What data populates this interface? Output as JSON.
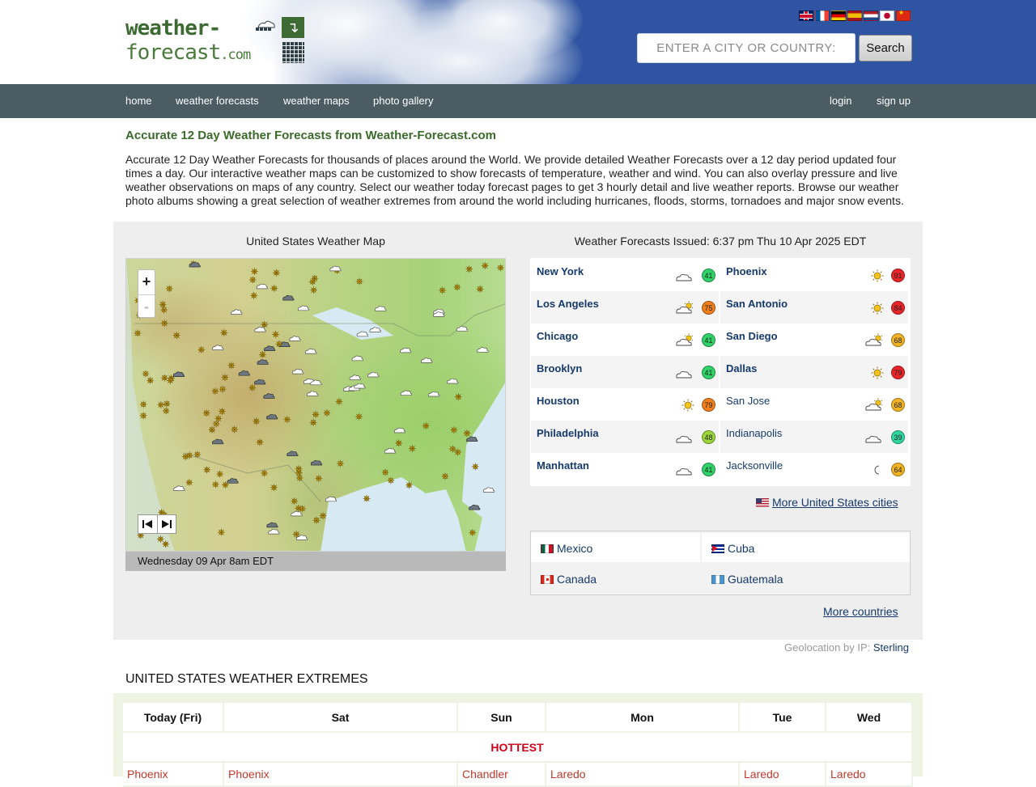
{
  "header": {
    "logo_line1": "weather-",
    "logo_line2": "forecast",
    "logo_com": ".com",
    "languages": [
      "uk-flag",
      "fr-flag",
      "de-flag",
      "es-flag",
      "nl-flag",
      "jp-flag",
      "cn-flag"
    ],
    "search_placeholder": "ENTER A CITY OR COUNTRY:",
    "search_button": "Search"
  },
  "nav": {
    "items": [
      "home",
      "weather forecasts",
      "weather maps",
      "photo gallery"
    ],
    "login": "login",
    "signup": "sign up"
  },
  "intro": {
    "title": "Accurate 12 Day Weather Forecasts from Weather-Forecast.com",
    "text": "Accurate 12 Day Weather Forecasts for thousands of places around the World. We provide detailed Weather Forecasts over a 12 day period updated four times a day. Our interactive weather maps can be customized to show forecasts of temperature, weather and wind. You can also overlay pressure and live weather observations on maps of any country. Select our weather today forecast pages to get 3 hourly detail and live weather reports. Browse our weather photo albums showing a great selection of weather extremes from around the world including hurricanes, floods, storms, tornadoes and major snow events."
  },
  "map": {
    "title": "United States Weather Map",
    "zoom_in": "+",
    "zoom_out": "-",
    "timestamp": "Wednesday 09 Apr 8am EDT"
  },
  "forecasts": {
    "issued": "Weather Forecasts Issued: 6:37 pm Thu 10 Apr 2025 EDT",
    "cities": [
      {
        "name": "New York",
        "icon": "cloud-icon",
        "temp": "41",
        "color": "#2fd36a"
      },
      {
        "name": "Phoenix",
        "icon": "sun-icon",
        "temp": "91",
        "color": "#e8262a"
      },
      {
        "name": "Los Angeles",
        "icon": "partly-cloudy-icon",
        "temp": "75",
        "color": "#f07f1c"
      },
      {
        "name": "San Antonio",
        "icon": "sun-icon",
        "temp": "84",
        "color": "#e8262a"
      },
      {
        "name": "Chicago",
        "icon": "partly-cloudy-icon",
        "temp": "41",
        "color": "#2fd36a"
      },
      {
        "name": "San Diego",
        "icon": "partly-cloudy-icon",
        "temp": "68",
        "color": "#f2b322"
      },
      {
        "name": "Brooklyn",
        "icon": "cloud-icon",
        "temp": "41",
        "color": "#2fd36a"
      },
      {
        "name": "Dallas",
        "icon": "sun-icon",
        "temp": "79",
        "color": "#e8262a"
      },
      {
        "name": "Houston",
        "icon": "sun-icon",
        "temp": "79",
        "color": "#f07f1c"
      },
      {
        "name": "San Jose",
        "icon": "partly-cloudy-icon",
        "temp": "68",
        "color": "#f2b322"
      },
      {
        "name": "Philadelphia",
        "icon": "cloud-icon",
        "temp": "48",
        "color": "#9bd63a"
      },
      {
        "name": "Indianapolis",
        "icon": "cloud-icon",
        "temp": "39",
        "color": "#2fd6a0"
      },
      {
        "name": "Manhattan",
        "icon": "cloud-icon",
        "temp": "41",
        "color": "#2fd36a"
      },
      {
        "name": "Jacksonville",
        "icon": "moon-icon",
        "temp": "64",
        "color": "#f2b322"
      }
    ],
    "more_cities": "More United States cities"
  },
  "countries": {
    "items": [
      "Mexico",
      "Cuba",
      "Canada",
      "Guatemala"
    ],
    "more": "More countries"
  },
  "geo": {
    "label": "Geolocation by IP:",
    "place": "Sterling"
  },
  "extremes": {
    "title": "UNITED STATES WEATHER EXTREMES",
    "days": [
      "Today (Fri)",
      "Sat",
      "Sun",
      "Mon",
      "Tue",
      "Wed"
    ],
    "hottest_label": "HOTTEST",
    "hottest_places": [
      "Phoenix",
      "Phoenix",
      "Chandler",
      "Laredo",
      "Laredo",
      "Laredo"
    ]
  }
}
